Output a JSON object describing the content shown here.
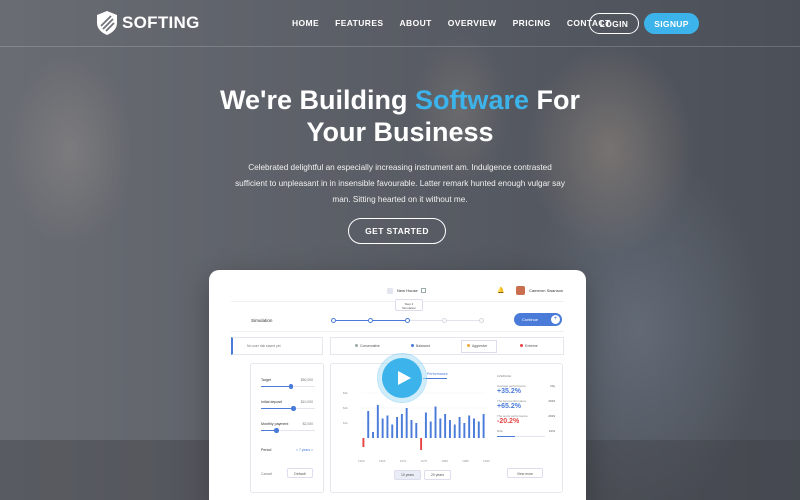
{
  "brand": {
    "name": "SOFTING",
    "accent_color": "#3cb3ea"
  },
  "nav": {
    "items": [
      "HOME",
      "FEATURES",
      "ABOUT",
      "OVERVIEW",
      "PRICING",
      "CONTACT"
    ],
    "login_label": "LOGIN",
    "signup_label": "SIGNUP"
  },
  "hero": {
    "title_part1": "We're Building ",
    "title_accent": "Software",
    "title_part2": " For",
    "title_line2": "Your Business",
    "description": "Celebrated delightful an especially increasing instrument am. Indulgence contrasted sufficient to unpleasant in in insensible favourable. Latter remark hunted enough vulgar say man. Sitting hearted on it without me.",
    "cta_label": "GET STARTED"
  },
  "dashboard": {
    "home_label": "New House",
    "user_name": "Cameron Swanson",
    "tooltip": [
      "Step 2",
      "Simulation"
    ],
    "section_title": "Simulation",
    "continue_label": "Continue",
    "filter_placeholder": "No user risk saved yet",
    "risk_options": [
      "Conservative",
      "Balanced",
      "Aggresive",
      "Extreme"
    ],
    "inputs": [
      {
        "label": "Target",
        "value": "$50,000",
        "fill": 0.55
      },
      {
        "label": "Initial deposit",
        "value": "$10,000",
        "fill": 0.6
      },
      {
        "label": "Monthly payment",
        "value": "$2,000",
        "fill": 0.28
      }
    ],
    "period_label": "Period",
    "period_value": "< 7 years >",
    "cancel_label": "Cancel",
    "default_label": "Default",
    "performance_tab": "Performance",
    "chart_ylabels": [
      "$3k",
      "$2k",
      "$1k"
    ],
    "chart_xlabels": [
      "1960",
      "1965",
      "1970",
      "1975",
      "1980",
      "1985",
      "1990"
    ],
    "year_options": [
      "10 years",
      "20 years"
    ],
    "stats_header": "AVERAGE",
    "stats": [
      {
        "label": "Average performance",
        "year": "20y",
        "value": "+35.2%",
        "tone": "pos"
      },
      {
        "label": "The best performance",
        "year": "2019",
        "value": "+65.2%",
        "tone": "pos"
      },
      {
        "label": "The worst performance",
        "year": "2019",
        "value": "-20.2%",
        "tone": "neg"
      }
    ],
    "risk_label": "Risk",
    "risk_value": "10%",
    "view_more_label": "View more"
  },
  "chart_data": {
    "type": "bar",
    "values": [
      -0.6,
      1.8,
      0.4,
      2.2,
      1.3,
      1.5,
      0.9,
      1.4,
      1.6,
      2.0,
      1.2,
      1.0,
      -0.8,
      1.7,
      1.1,
      2.1,
      1.3,
      1.6,
      1.2,
      0.9,
      1.4,
      1.0,
      1.5,
      1.3,
      1.1,
      1.6
    ],
    "colors": {
      "positive": "#4a7bd9",
      "negative": "#e64545"
    }
  }
}
